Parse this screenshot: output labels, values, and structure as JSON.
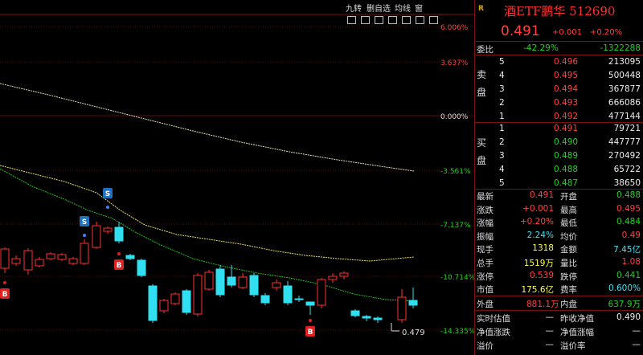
{
  "toolbar": {
    "nine_turn": "九转",
    "delete_self": "删自选",
    "lines": "均线",
    "window": "窗"
  },
  "chart": {
    "pct_labels": [
      "6.006%",
      "3.637%",
      "0.000%",
      "-3.561%",
      "-7.137%",
      "-10.714%",
      "-14.335%"
    ],
    "low_price_label": "0.479",
    "signals": {
      "buy": "B",
      "sell": "S"
    },
    "colors": {
      "up": "#ff3030",
      "down": "#30e0f0",
      "ma_fast": "#20c020",
      "ma_slow": "#e8e060",
      "ma_long": "#e0e0c0"
    }
  },
  "quote": {
    "r_tag": "R",
    "name": "酒ETF鹏华",
    "code": "512690",
    "price": "0.491",
    "change": "+0.001",
    "change_pct": "+0.20%",
    "ratio_label": "委比",
    "ratio_pct": "-42.29%",
    "ratio_diff": "-1322288",
    "ask_side_label": "卖盘",
    "bid_side_label": "买盘",
    "asks": [
      {
        "lvl": "5",
        "price": "0.496",
        "vol": "213095"
      },
      {
        "lvl": "4",
        "price": "0.495",
        "vol": "500448"
      },
      {
        "lvl": "3",
        "price": "0.494",
        "vol": "367877"
      },
      {
        "lvl": "2",
        "price": "0.493",
        "vol": "666086"
      },
      {
        "lvl": "1",
        "price": "0.492",
        "vol": "477144"
      }
    ],
    "bids": [
      {
        "lvl": "1",
        "price": "0.491",
        "vol": "79721"
      },
      {
        "lvl": "2",
        "price": "0.490",
        "vol": "447777"
      },
      {
        "lvl": "3",
        "price": "0.489",
        "vol": "270492"
      },
      {
        "lvl": "4",
        "price": "0.488",
        "vol": "65722"
      },
      {
        "lvl": "5",
        "price": "0.487",
        "vol": "38650"
      }
    ],
    "stats": [
      {
        "l1": "最新",
        "v1": "0.491",
        "c1": "red",
        "l2": "开盘",
        "v2": "0.488",
        "c2": "green"
      },
      {
        "l1": "涨跌",
        "v1": "+0.001",
        "c1": "red",
        "l2": "最高",
        "v2": "0.495",
        "c2": "red"
      },
      {
        "l1": "涨幅",
        "v1": "+0.20%",
        "c1": "red",
        "l2": "最低",
        "v2": "0.484",
        "c2": "green"
      },
      {
        "l1": "振幅",
        "v1": "2.24%",
        "c1": "cyan",
        "l2": "均价",
        "v2": "0.49",
        "c2": "red"
      },
      {
        "l1": "现手",
        "v1": "1318",
        "c1": "yellow",
        "l2": "金额",
        "v2": "7.45亿",
        "c2": "cyan"
      },
      {
        "l1": "总手",
        "v1": "1519万",
        "c1": "yellow",
        "l2": "量比",
        "v2": "1.08",
        "c2": "red"
      },
      {
        "l1": "涨停",
        "v1": "0.539",
        "c1": "red",
        "l2": "跌停",
        "v2": "0.441",
        "c2": "green"
      },
      {
        "l1": "市值",
        "v1": "175.6亿",
        "c1": "yellow",
        "l2": "费率",
        "v2": "0.600%",
        "c2": "cyan"
      }
    ],
    "outer_label": "外盘",
    "outer_val": "881.1万",
    "inner_label": "内盘",
    "inner_val": "637.9万",
    "nav": [
      {
        "l1": "实时估值",
        "v1": "—",
        "l2": "昨收净值",
        "v2": "0.490"
      },
      {
        "l1": "净值涨跌",
        "v1": "—",
        "l2": "净值涨幅",
        "v2": "—"
      },
      {
        "l1": "溢价",
        "v1": "—",
        "l2": "溢价率",
        "v2": "—"
      }
    ]
  }
}
